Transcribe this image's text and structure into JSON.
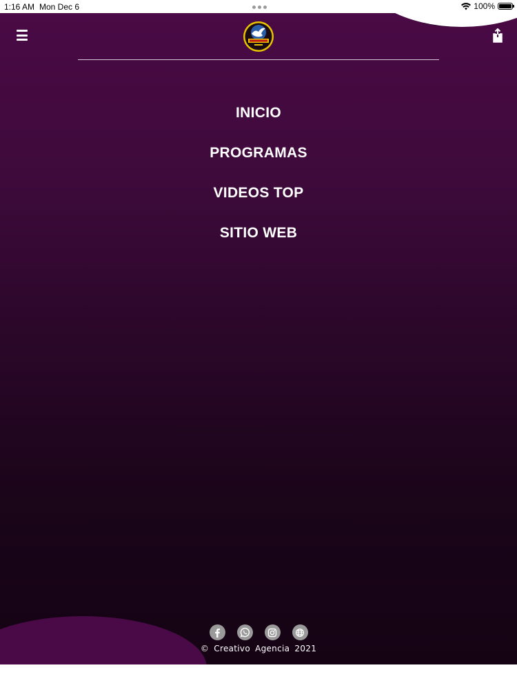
{
  "status_bar": {
    "time": "1:16 AM",
    "date": "Mon Dec 6",
    "battery": "100%",
    "battery_level": 1.0,
    "wifi_icon": "wifi-icon"
  },
  "header": {
    "menu_icon": "hamburger-menu-icon",
    "share_icon": "share-icon",
    "logo_icon": "dove-logo-icon"
  },
  "nav": {
    "items": [
      {
        "label": "INICIO"
      },
      {
        "label": "PROGRAMAS"
      },
      {
        "label": "VIDEOS TOP"
      },
      {
        "label": "SITIO WEB"
      }
    ]
  },
  "footer": {
    "social": [
      "facebook-icon",
      "whatsapp-icon",
      "instagram-icon",
      "globe-icon"
    ],
    "copyright": "© Creativo Agencia 2021"
  },
  "colors": {
    "background_top": "#4a0a45",
    "background_bottom": "#150314",
    "text": "#ffffff",
    "social_icon_bg": "#9a9a9a"
  }
}
